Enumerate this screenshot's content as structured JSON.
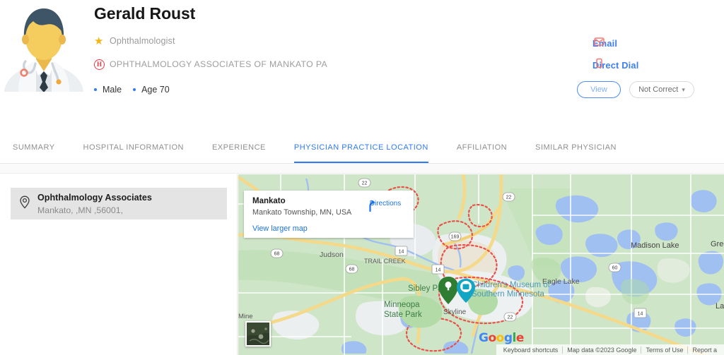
{
  "profile": {
    "name": "Gerald Roust",
    "specialty": "Ophthalmologist",
    "specialty_icon": "star-icon",
    "organization": "OPHTHALMOLOGY ASSOCIATES OF MANKATO PA",
    "organization_icon": "hospital-h-icon",
    "gender": "Male",
    "age": "Age 70",
    "avatar_icon": "doctor-avatar-illustration"
  },
  "actions": {
    "email_label": "Email",
    "email_icon": "envelope-icon",
    "direct_dial_label": "Direct Dial",
    "direct_dial_icon": "mobile-phone-icon",
    "view_label": "View",
    "not_correct_label": "Not Correct",
    "not_correct_chevron": "chevron-down-icon"
  },
  "tabs": [
    {
      "label": "SUMMARY",
      "active": false
    },
    {
      "label": "HOSPITAL INFORMATION",
      "active": false
    },
    {
      "label": "EXPERIENCE",
      "active": false
    },
    {
      "label": "PHYSICIAN PRACTICE LOCATION",
      "active": true
    },
    {
      "label": "AFFILIATION",
      "active": false
    },
    {
      "label": "SIMILAR PHYSICIAN",
      "active": false
    }
  ],
  "location_card": {
    "icon": "map-pin-icon",
    "name": "Ophthalmology Associates",
    "address": "Mankato, ,MN ,56001,"
  },
  "map": {
    "info_card": {
      "title": "Mankato",
      "subtitle": "Mankato Township, MN, USA",
      "view_larger_label": "View larger map",
      "directions_label": "Directions",
      "directions_icon": "directions-arrow-icon"
    },
    "satellite_toggle_label": "satellite-thumbnail",
    "watermark": "Google",
    "attribution": [
      "Keyboard shortcuts",
      "Map data ©2023 Google",
      "Terms of Use",
      "Report a"
    ],
    "place_labels": [
      "Judson",
      "Sibley Park",
      "Minneopa State Park",
      "Skyline",
      "TRAIL CREEK",
      "Children's Museum of Southern Minnesota",
      "Eagle Lake",
      "Madison Lake",
      "Greenland",
      "Lake Elysia",
      "Mine"
    ],
    "road_shields": [
      "68",
      "68",
      "14",
      "14",
      "169",
      "22",
      "22",
      "60",
      "14"
    ]
  },
  "colors": {
    "accent_blue": "#2f7bf6",
    "link_blue": "#1a73e8",
    "coral": "#f8796f",
    "star_gold": "#f5b517",
    "hospital_red": "#f0333f",
    "map_land": "#cfe5c8",
    "map_water": "#9fc0f0",
    "map_road": "#f5d98b"
  }
}
